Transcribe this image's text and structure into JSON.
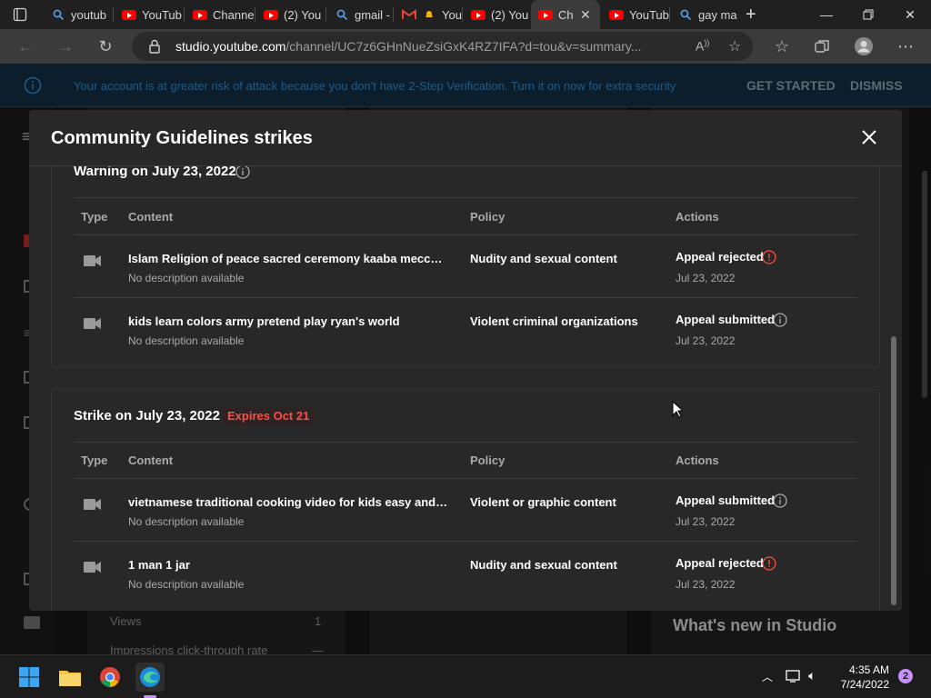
{
  "browser": {
    "tabs": [
      {
        "label": "youtub",
        "icon": "search-icon"
      },
      {
        "label": "YouTub",
        "icon": "youtube-icon"
      },
      {
        "label": "Channe",
        "icon": "youtube-icon"
      },
      {
        "label": "(2) You",
        "icon": "youtube-icon"
      },
      {
        "label": "gmail -",
        "icon": "search-icon"
      },
      {
        "label": "You",
        "icon": "gmail-icon"
      },
      {
        "label": "(2) You",
        "icon": "youtube-icon"
      },
      {
        "label": "Ch",
        "icon": "youtube-studio-icon"
      },
      {
        "label": "YouTub",
        "icon": "youtube-icon"
      },
      {
        "label": "gay ma",
        "icon": "search-icon"
      }
    ],
    "url_host": "studio.youtube.com",
    "url_rest": "/channel/UC7z6GHnNueZsiGxK4RZ7IFA?d=tou&v=summary..."
  },
  "banner": {
    "text": "Your account is at greater risk of attack because you don't have 2-Step Verification. Turn it on now for extra security",
    "get_started": "GET STARTED",
    "dismiss": "DISMISS"
  },
  "background": {
    "views_label": "Views",
    "views_value": "1",
    "ctr_label": "Impressions click-through rate",
    "ctr_value": "—",
    "whats_new": "What's new in Studio"
  },
  "modal": {
    "title": "Community Guidelines strikes",
    "columns": {
      "type": "Type",
      "content": "Content",
      "policy": "Policy",
      "actions": "Actions"
    },
    "warning": {
      "title": "Warning on July 23, 2022",
      "rows": [
        {
          "title": "Islam Religion of peace sacred ceremony kaaba mecce hajj...",
          "desc": "No description available",
          "policy": "Nudity and sexual content",
          "appeal": "Appeal rejected",
          "date": "Jul 23, 2022",
          "status": "rejected"
        },
        {
          "title": "kids learn colors army pretend play ryan's world",
          "desc": "No description available",
          "policy": "Violent criminal organizations",
          "appeal": "Appeal submitted",
          "date": "Jul 23, 2022",
          "status": "submitted"
        }
      ]
    },
    "strike": {
      "title": "Strike on July 23, 2022",
      "expires": "Expires Oct 21",
      "rows": [
        {
          "title": "vietnamese traditional cooking video for kids easy and che...",
          "desc": "No description available",
          "policy": "Violent or graphic content",
          "appeal": "Appeal submitted",
          "date": "Jul 23, 2022",
          "status": "submitted"
        },
        {
          "title": "1 man 1 jar",
          "desc": "No description available",
          "policy": "Nudity and sexual content",
          "appeal": "Appeal rejected",
          "date": "Jul 23, 2022",
          "status": "rejected"
        }
      ]
    }
  },
  "taskbar": {
    "time": "4:35 AM",
    "date": "7/24/2022",
    "notifications": "2"
  },
  "colors": {
    "rejected": "#ff4e45",
    "submitted": "#aaaaaa",
    "banner_link": "#1f5a86"
  }
}
